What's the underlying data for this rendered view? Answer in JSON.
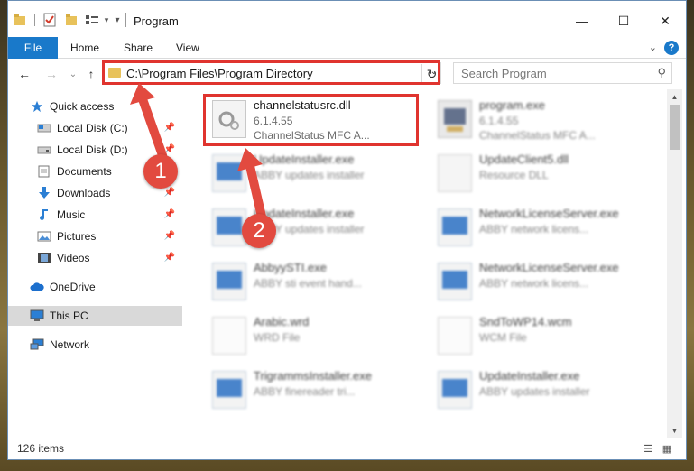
{
  "window": {
    "title": "Program",
    "controls": {
      "minimize": "—",
      "maximize": "☐",
      "close": "✕"
    }
  },
  "ribbon": {
    "tabs": [
      "File",
      "Home",
      "Share",
      "View"
    ],
    "help": "?"
  },
  "address": {
    "path": "C:\\Program Files\\Program Directory",
    "search_placeholder": "Search Program"
  },
  "sidebar": {
    "items": [
      {
        "label": "Quick access",
        "icon": "star-icon",
        "pinned": false
      },
      {
        "label": "Local Disk (C:)",
        "icon": "disk-icon",
        "pinned": true
      },
      {
        "label": "Local Disk (D:)",
        "icon": "disk-icon",
        "pinned": true
      },
      {
        "label": "Documents",
        "icon": "documents-icon",
        "pinned": true
      },
      {
        "label": "Downloads",
        "icon": "download-icon",
        "pinned": true
      },
      {
        "label": "Music",
        "icon": "music-icon",
        "pinned": true
      },
      {
        "label": "Pictures",
        "icon": "pictures-icon",
        "pinned": true
      },
      {
        "label": "Videos",
        "icon": "videos-icon",
        "pinned": true
      },
      {
        "label": "OneDrive",
        "icon": "cloud-icon",
        "pinned": false
      },
      {
        "label": "This PC",
        "icon": "computer-icon",
        "pinned": false,
        "selected": true
      },
      {
        "label": "Network",
        "icon": "network-icon",
        "pinned": false
      }
    ]
  },
  "files": {
    "col1": [
      {
        "name": "channelstatusrc.dll",
        "line2": "6.1.4.55",
        "line3": "ChannelStatus MFC A...",
        "icon": "dll-icon",
        "highlighted": true
      },
      {
        "name": "UpdateInstaller.exe",
        "line2": "ABBY updates installer",
        "icon": "exe-icon"
      },
      {
        "name": "UpdateInstaller.exe",
        "line2": "ABBY updates installer",
        "icon": "exe-icon"
      },
      {
        "name": "AbbyySTI.exe",
        "line2": "ABBY sti event hand...",
        "icon": "exe-icon"
      },
      {
        "name": "Arabic.wrd",
        "line2": "WRD File",
        "icon": "document-icon"
      },
      {
        "name": "TrigrammsInstaller.exe",
        "line2": "ABBY finereader tri...",
        "icon": "exe-icon"
      }
    ],
    "col2": [
      {
        "name": "program.exe",
        "line2": "6.1.4.55",
        "line3": "ChannelStatus MFC A...",
        "icon": "program-icon"
      },
      {
        "name": "UpdateClient5.dll",
        "line2": "Resource DLL",
        "icon": "dll-icon"
      },
      {
        "name": "NetworkLicenseServer.exe",
        "line2": "ABBY network licens...",
        "icon": "exe-icon"
      },
      {
        "name": "NetworkLicenseServer.exe",
        "line2": "ABBY network licens...",
        "icon": "exe-icon"
      },
      {
        "name": "SndToWP14.wcm",
        "line2": "WCM File",
        "icon": "document-icon"
      },
      {
        "name": "UpdateInstaller.exe",
        "line2": "ABBY updates installer",
        "icon": "exe-icon"
      }
    ]
  },
  "status": {
    "items": "126 items"
  },
  "callouts": [
    "1",
    "2"
  ],
  "colors": {
    "accent": "#1979ca",
    "highlight": "#e0342f",
    "callout": "#e24a3f",
    "folder": "#e8c25b"
  }
}
